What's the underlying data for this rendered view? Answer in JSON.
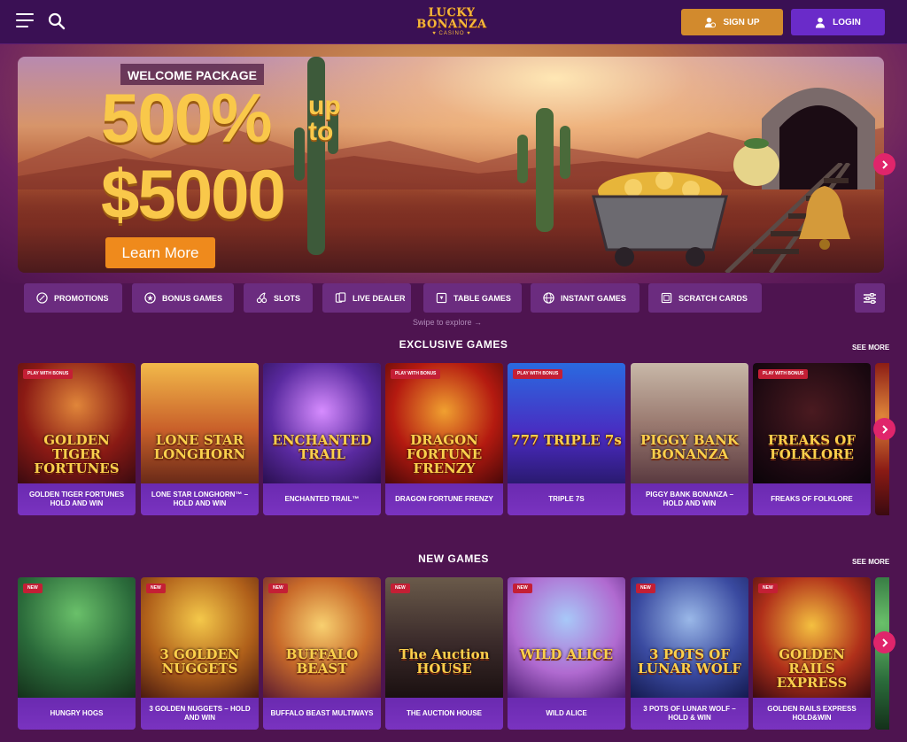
{
  "header": {
    "logo_line1": "LUCKY",
    "logo_line2": "BONANZA",
    "logo_line3": "♥ CASINO ♥",
    "signup_label": "SIGN UP",
    "login_label": "LOGIN",
    "signup_color": "#d28a2d",
    "login_color": "#6a2bc9"
  },
  "hero": {
    "tag": "WELCOME PACKAGE",
    "big1": "500%",
    "up": "up",
    "to": "to",
    "big2": "$5000",
    "cta": "Learn More",
    "slides": 8,
    "active_slide": 1
  },
  "categories": [
    {
      "label": "PROMOTIONS",
      "icon": "percent-icon"
    },
    {
      "label": "BONUS GAMES",
      "icon": "star-icon"
    },
    {
      "label": "SLOTS",
      "icon": "cherries-icon"
    },
    {
      "label": "LIVE DEALER",
      "icon": "cards-icon"
    },
    {
      "label": "TABLE GAMES",
      "icon": "table-icon"
    },
    {
      "label": "INSTANT GAMES",
      "icon": "globe-icon"
    },
    {
      "label": "SCRATCH CARDS",
      "icon": "ticket-icon"
    }
  ],
  "swipe_hint": "Swipe to explore →",
  "exclusive": {
    "title": "EXCLUSIVE GAMES",
    "see_more": "SEE MORE",
    "games": [
      {
        "name": "GOLDEN TIGER FORTUNES HOLD AND WIN",
        "art_title": "GOLDEN TIGER FORTUNES",
        "badge": "PLAY WITH BONUS"
      },
      {
        "name": "LONE STAR LONGHORN™ – HOLD AND WIN",
        "art_title": "LONE STAR LONGHORN",
        "badge": ""
      },
      {
        "name": "ENCHANTED TRAIL™",
        "art_title": "ENCHANTED TRAIL",
        "badge": ""
      },
      {
        "name": "DRAGON FORTUNE FRENZY",
        "art_title": "DRAGON FORTUNE FRENZY",
        "badge": "PLAY WITH BONUS"
      },
      {
        "name": "TRIPLE 7S",
        "art_title": "777 TRIPLE 7s",
        "badge": "PLAY WITH BONUS"
      },
      {
        "name": "PIGGY BANK BONANZA – HOLD AND WIN",
        "art_title": "PIGGY BANK BONANZA",
        "badge": ""
      },
      {
        "name": "FREAKS OF FOLKLORE",
        "art_title": "FREAKS OF FOLKLORE",
        "badge": "PLAY WITH BONUS"
      }
    ]
  },
  "new_games": {
    "title": "NEW GAMES",
    "see_more": "SEE MORE",
    "games": [
      {
        "name": "HUNGRY HOGS",
        "art_title": "",
        "badge": "NEW"
      },
      {
        "name": "3 GOLDEN NUGGETS – HOLD AND WIN",
        "art_title": "3 GOLDEN NUGGETS",
        "badge": "NEW"
      },
      {
        "name": "BUFFALO BEAST MULTIWAYS",
        "art_title": "BUFFALO BEAST",
        "badge": "NEW"
      },
      {
        "name": "THE AUCTION HOUSE",
        "art_title": "The Auction HOUSE",
        "badge": "NEW"
      },
      {
        "name": "WILD ALICE",
        "art_title": "WILD ALICE",
        "badge": "NEW"
      },
      {
        "name": "3 POTS OF LUNAR WOLF – HOLD & WIN",
        "art_title": "3 POTS OF LUNAR WOLF",
        "badge": "NEW"
      },
      {
        "name": "GOLDEN RAILS EXPRESS HOLD&WIN",
        "art_title": "GOLDEN RAILS EXPRESS",
        "badge": "NEW"
      }
    ]
  }
}
